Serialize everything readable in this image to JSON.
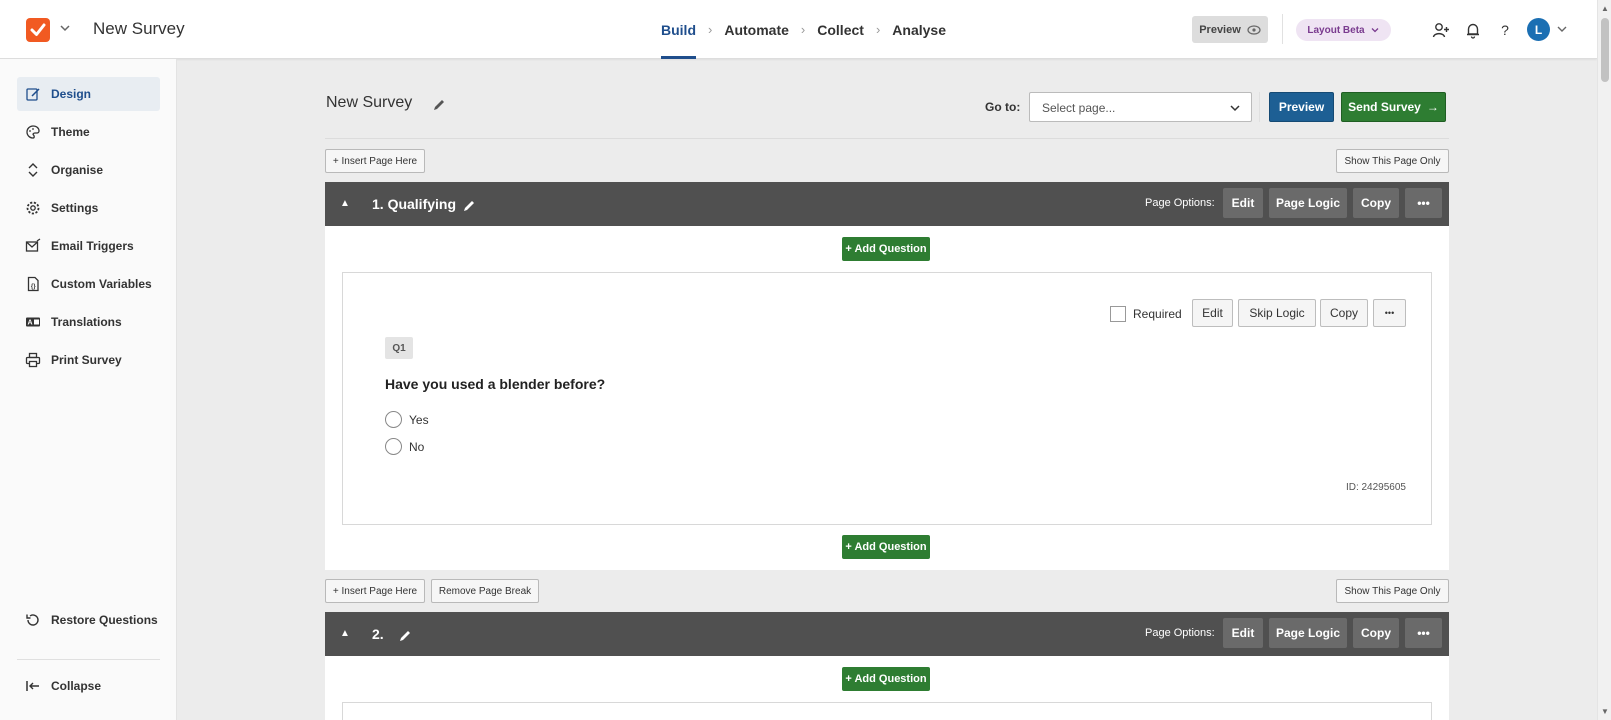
{
  "app": {
    "title": "New Survey",
    "nav": [
      "Build",
      "Automate",
      "Collect",
      "Analyse"
    ],
    "preview_label": "Preview",
    "layout_beta_label": "Layout Beta",
    "avatar_initial": "L"
  },
  "sidebar": {
    "items": [
      {
        "label": "Design",
        "icon": "edit-icon"
      },
      {
        "label": "Theme",
        "icon": "palette-icon"
      },
      {
        "label": "Organise",
        "icon": "sort-icon"
      },
      {
        "label": "Settings",
        "icon": "gear-icon"
      },
      {
        "label": "Email Triggers",
        "icon": "email-icon"
      },
      {
        "label": "Custom Variables",
        "icon": "variable-file-icon"
      },
      {
        "label": "Translations",
        "icon": "translate-icon"
      },
      {
        "label": "Print Survey",
        "icon": "printer-icon"
      }
    ],
    "restore_label": "Restore Questions",
    "collapse_label": "Collapse"
  },
  "toolbar": {
    "survey_title": "New Survey",
    "goto_label": "Go to:",
    "select_placeholder": "Select page...",
    "preview_label": "Preview",
    "send_label": "Send Survey"
  },
  "pages": {
    "insert_label": "+ Insert Page Here",
    "remove_break_label": "Remove Page Break",
    "show_only_label": "Show This Page Only",
    "options_label": "Page Options:",
    "edit_label": "Edit",
    "logic_label": "Page Logic",
    "copy_label": "Copy",
    "more_label": "•••",
    "add_question_label": "+ Add Question",
    "page1_title": "1. Qualifying",
    "page2_title": "2."
  },
  "question": {
    "required_label": "Required",
    "edit_label": "Edit",
    "skip_logic_label": "Skip Logic",
    "copy_label": "Copy",
    "more_label": "•••",
    "number": "Q1",
    "text": "Have you used a blender before?",
    "options": [
      "Yes",
      "No"
    ],
    "id_text": "ID: 24295605"
  },
  "colors": {
    "accent": "#1f4e8c",
    "brand": "#f15a22",
    "green": "#2e7d32",
    "blue_button": "#1d5f94",
    "page_header": "#505050"
  }
}
